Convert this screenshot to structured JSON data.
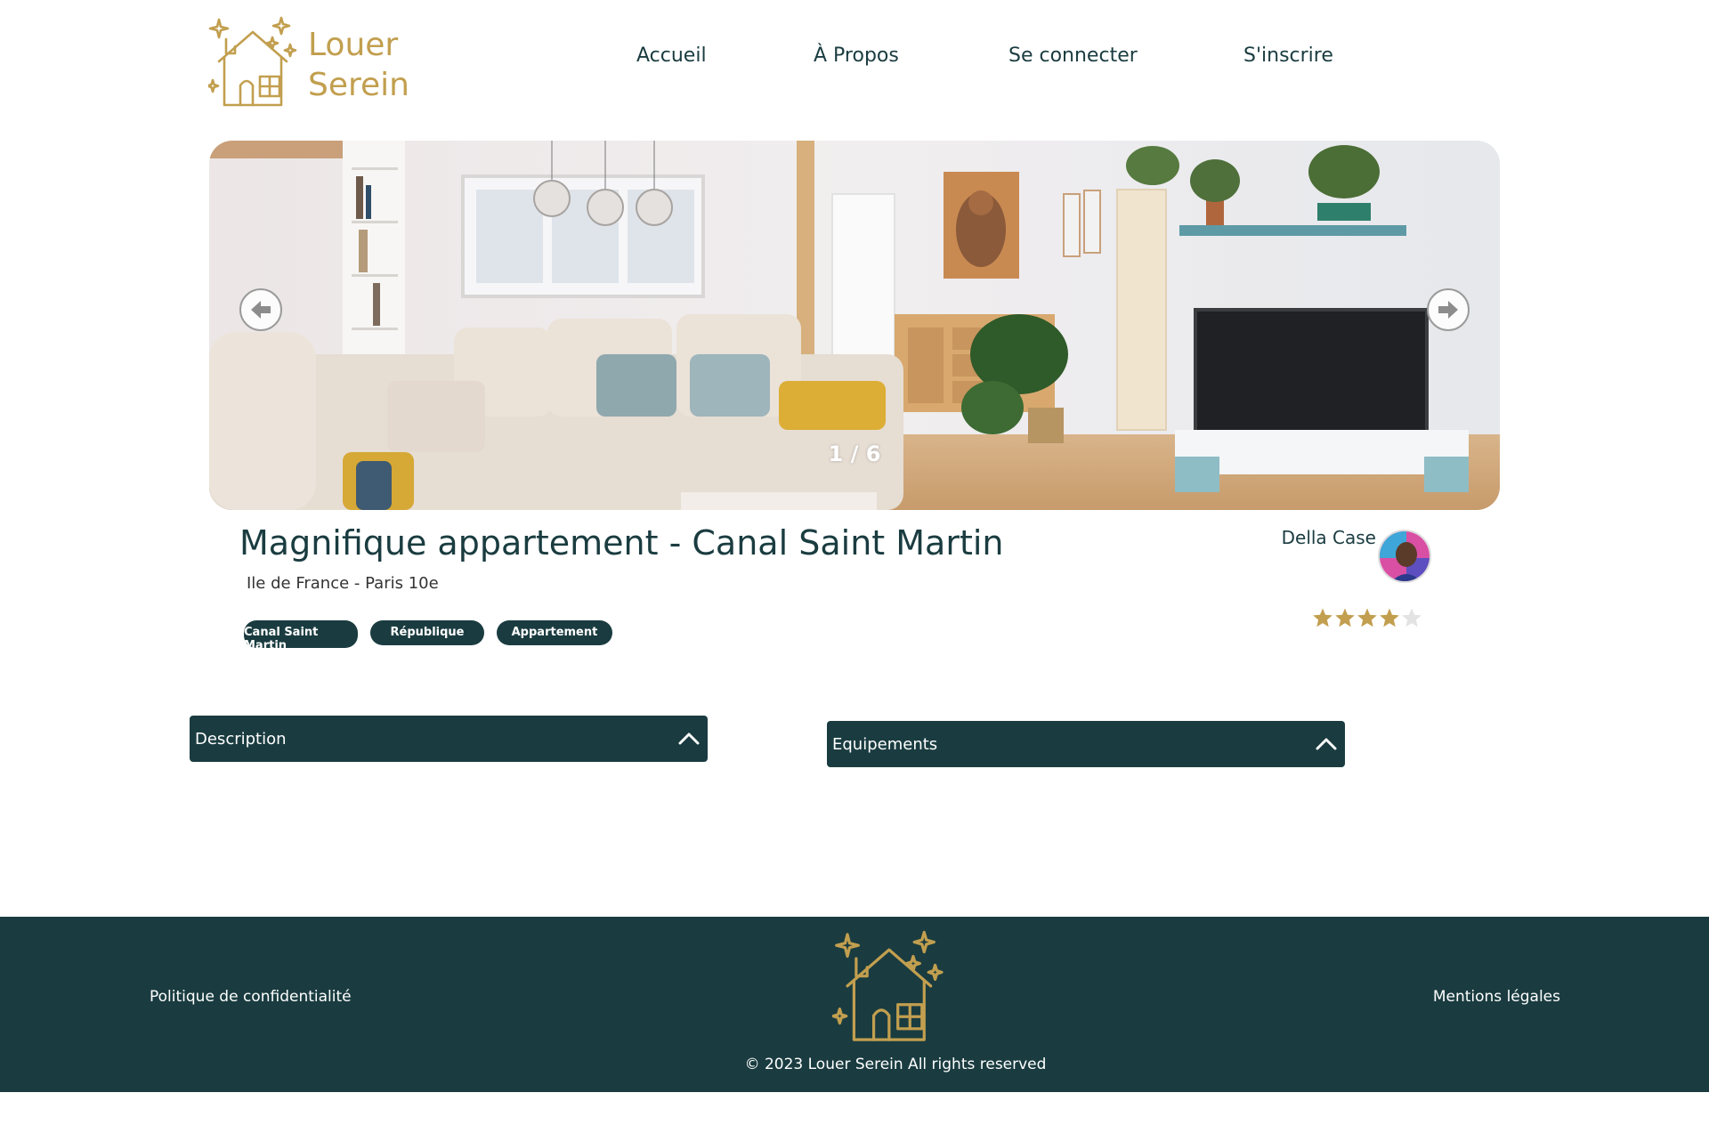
{
  "brand": {
    "name_line1": "Louer",
    "name_line2": "Serein",
    "accent_color": "#c29f4f",
    "dark_color": "#1a3c40"
  },
  "nav": {
    "items": [
      {
        "label": "Accueil"
      },
      {
        "label": "À Propos"
      },
      {
        "label": "Se connecter"
      },
      {
        "label": "S'inscrire"
      }
    ]
  },
  "carousel": {
    "counter": "1 / 6",
    "prev_icon": "arrow-left-icon",
    "next_icon": "arrow-right-icon"
  },
  "listing": {
    "title": "Magnifique appartement - Canal Saint Martin",
    "location": "Ile de France - Paris 10e",
    "tags": [
      {
        "label": "Canal Saint Martin"
      },
      {
        "label": "République"
      },
      {
        "label": "Appartement"
      }
    ],
    "host_name": "Della Case",
    "rating": 4,
    "rating_max": 5
  },
  "collapses": {
    "description": {
      "label": "Description"
    },
    "equipements": {
      "label": "Equipements"
    }
  },
  "footer": {
    "privacy": "Politique de confidentialité",
    "legal": "Mentions légales",
    "copyright": "© 2023 Louer Serein All rights reserved"
  }
}
